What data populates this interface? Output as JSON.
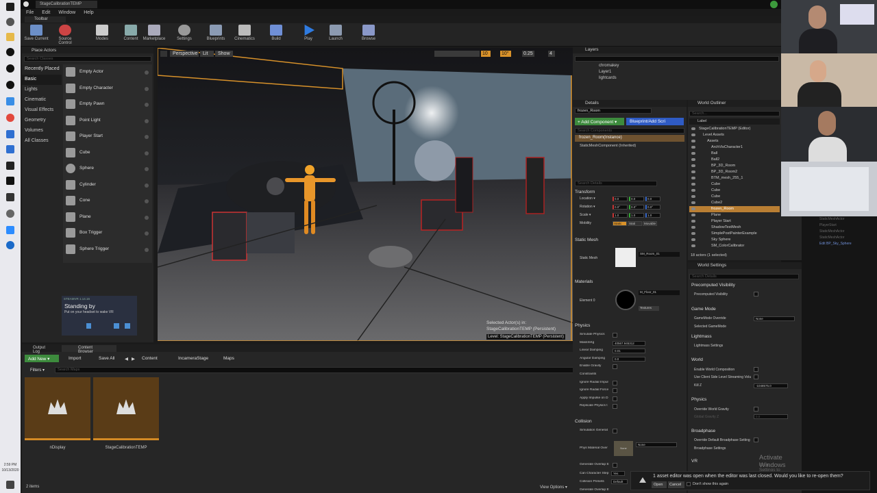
{
  "window": {
    "title": "StageCalibrationTEMP"
  },
  "menu": [
    "File",
    "Edit",
    "Window",
    "Help"
  ],
  "toolbar": {
    "tab": "Toolbar",
    "buttons": [
      "Save Current",
      "Source Control",
      "Modes",
      "Content",
      "Marketplace",
      "Settings",
      "Blueprints",
      "Cinematics",
      "Build",
      "Play",
      "Launch",
      "Browse"
    ]
  },
  "place_actors": {
    "tab": "Place Actors",
    "search": "Search Classes",
    "categories": [
      "Recently Placed",
      "Basic",
      "Lights",
      "Cinematic",
      "Visual Effects",
      "Geometry",
      "Volumes",
      "All Classes"
    ],
    "items": [
      "Empty Actor",
      "Empty Character",
      "Empty Pawn",
      "Point Light",
      "Player Start",
      "Cube",
      "Sphere",
      "Cylinder",
      "Cone",
      "Plane",
      "Box Trigger",
      "Sphere Trigger"
    ]
  },
  "steamvr": {
    "version": "STEAMVR 1.14.16",
    "title": "Standing by",
    "subtitle": "Put on your headset to wake VR"
  },
  "viewport": {
    "perspective": "Perspective",
    "lit": "Lit",
    "show": "Show",
    "grid": "10",
    "angle": "10°",
    "scale": "0.25",
    "cam": "4",
    "selected": "Selected Actor(s) in:",
    "selected_level": "StageCalibrationTEMP (Persistent)",
    "level": "Level:  StageCalibrationTEMP (Persistent)"
  },
  "layers": {
    "tab": "Layers",
    "items": [
      "chromakey",
      "Layer1",
      "lightcards"
    ]
  },
  "details": {
    "tab": "Details",
    "name": "frozen_Room",
    "add_component": "+ Add Component ▾",
    "blueprint": "Blueprint/Add Scri",
    "search_components": "Search Components",
    "instance": "frozen_Room(Instance)",
    "component": "StaticMeshComponent (Inherited)",
    "search_details": "Search Details",
    "transform": {
      "header": "Transform",
      "labels": [
        "Location ▾",
        "Rotation ▾",
        "Scale ▾",
        "Mobility"
      ],
      "loc": [
        "0.0",
        "0.0",
        "0.0"
      ],
      "rot": [
        "0.0°",
        "0.0°",
        "0.0°"
      ],
      "scale": [
        "1.0",
        "1.0",
        "1.0"
      ],
      "mobility": [
        "Static",
        "Stati",
        "Movable"
      ]
    },
    "static_mesh": {
      "header": "Static Mesh",
      "label": "Static Mesh",
      "value": "SM_Room_01"
    },
    "materials": {
      "header": "Materials",
      "label": "Element 0",
      "value": "M_Floor_01",
      "textures": "Textures"
    },
    "physics": {
      "header": "Physics",
      "labels": [
        "Simulate Physics",
        "MassInKg",
        "Linear Damping",
        "Angular Damping",
        "Enable Gravity",
        "Constraints",
        "Ignore Radial Impul",
        "Ignore Radial Force",
        "Apply Impulse on D",
        "Replicate Physics t"
      ],
      "mass": "40567.945312",
      "linear": "0.01",
      "angular": "0.0"
    },
    "collision": {
      "header": "Collision",
      "labels": [
        "Simulation Generat",
        "Phys Material Over",
        "Generate Overlap E",
        "Can Character Step",
        "Collision Presets",
        "Generate Overlap E"
      ],
      "none": "None",
      "none2": "None",
      "yes": "Yes",
      "default": "Default"
    }
  },
  "outliner": {
    "tab": "World Outliner",
    "search": "Search...",
    "label_col": "Label",
    "rows": [
      "StageCalibrationTEMP (Editor)",
      "Level Assets",
      "Assets",
      "ArchVisCharacter1",
      "Ball",
      "Ball2",
      "BP_3D_Room",
      "BP_3D_Room2",
      "BTM_mesh_255_1",
      "Cube",
      "Cube",
      "Cube",
      "Cube2",
      "frozen_Room",
      "Plane",
      "Player Start",
      "ShadowTestMesh",
      "SimplePostPainterExample",
      "Sky Sphere",
      "SM_ColorCalibrator"
    ],
    "types": [
      "StaticMeshActor",
      "PlayerStart",
      "StaticMeshActor",
      "StaticMeshActor",
      "Edit BP_Sky_Sphere"
    ],
    "count": "18 actors (1 selected)",
    "view_options": "View Options ▾"
  },
  "world_settings": {
    "tab": "World Settings",
    "search": "Search Details",
    "sections": [
      "Precomputed Visibility",
      "Game Mode",
      "Lightmass",
      "World",
      "Physics",
      "Broadphase",
      "VR"
    ],
    "labels": {
      "precomputed": "Precomputed Visibility",
      "gm_override": "GameMode Override",
      "selected_gm": "Selected GameMode",
      "lightmass_settings": "Lightmass Settings",
      "world_comp": "Enable World Composition",
      "client_side": "Use Client Side Level Streaming Volu",
      "killz": "Kill Z",
      "override_gravity": "Override World Gravity",
      "global_gravity": "Global Gravity Z",
      "override_broadphase": "Override Default Broadphase Setting",
      "broadphase_settings": "Broadphase Settings"
    },
    "gm_value": "None",
    "killz_value": "-1048575.0",
    "gravity_value": "0.0"
  },
  "notice": {
    "text": "1 asset editor was open when the editor was last closed. Would you like to re-open them?",
    "open": "Open",
    "cancel": "Cancel",
    "dont": "Don't show this again",
    "rendering": "Rendering"
  },
  "activate": {
    "title": "Activate Windows",
    "sub": "Go to Settings to activate Windows."
  },
  "bottom": {
    "tab1": "Output Log",
    "tab2": "Content Browser",
    "add_new": "Add New ▾",
    "import": "Import",
    "save_all": "Save All",
    "path": [
      "Content",
      "IncameraStage",
      "Maps"
    ],
    "filters": "Filters ▾",
    "search": "Search Maps",
    "assets": [
      "nDisplay",
      "StageCalibrationTEMP"
    ],
    "count": "2 items",
    "view_options": "View Options ▾"
  },
  "taskbar": {
    "time": "2:59 PM",
    "date": "10/13/2020"
  }
}
